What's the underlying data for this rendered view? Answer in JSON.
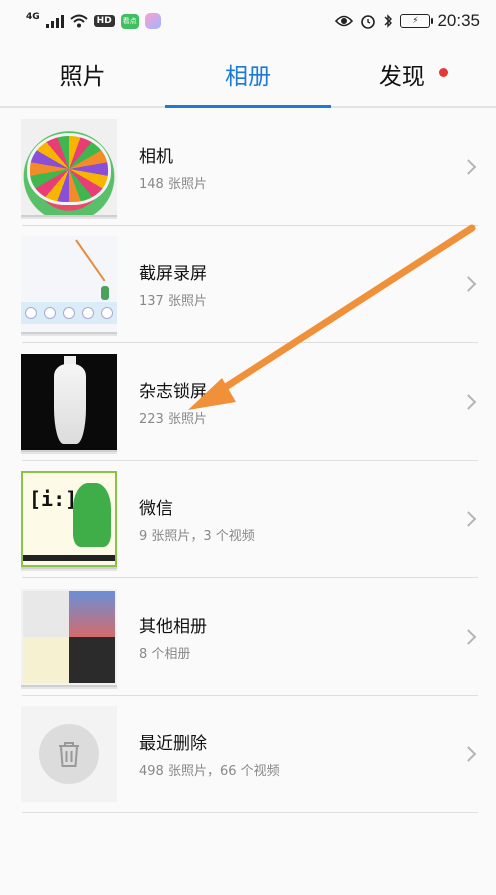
{
  "status_bar": {
    "network": "4G",
    "hd": "HD",
    "app_chip": "看点",
    "time": "20:35",
    "icons": [
      "signal-icon",
      "wifi-icon",
      "eye-icon",
      "alarm-icon",
      "bluetooth-icon",
      "battery-icon"
    ]
  },
  "tabs": [
    {
      "label": "照片",
      "active": false
    },
    {
      "label": "相册",
      "active": true
    },
    {
      "label": "发现",
      "active": false,
      "has_dot": true
    }
  ],
  "albums": [
    {
      "title": "相机",
      "subtitle": "148 张照片"
    },
    {
      "title": "截屏录屏",
      "subtitle": "137 张照片"
    },
    {
      "title": "杂志锁屏",
      "subtitle": "223 张照片"
    },
    {
      "title": "微信",
      "subtitle": "9 张照片，3 个视频"
    },
    {
      "title": "其他相册",
      "subtitle": "8 个相册"
    },
    {
      "title": "最近删除",
      "subtitle": "498 张照片，66 个视频"
    }
  ],
  "thumbnail_text": {
    "wechat_symbol": "[i:]"
  },
  "colors": {
    "accent": "#1b7bd6",
    "annotation_arrow": "#f0913a",
    "notification_dot": "#e53935"
  }
}
